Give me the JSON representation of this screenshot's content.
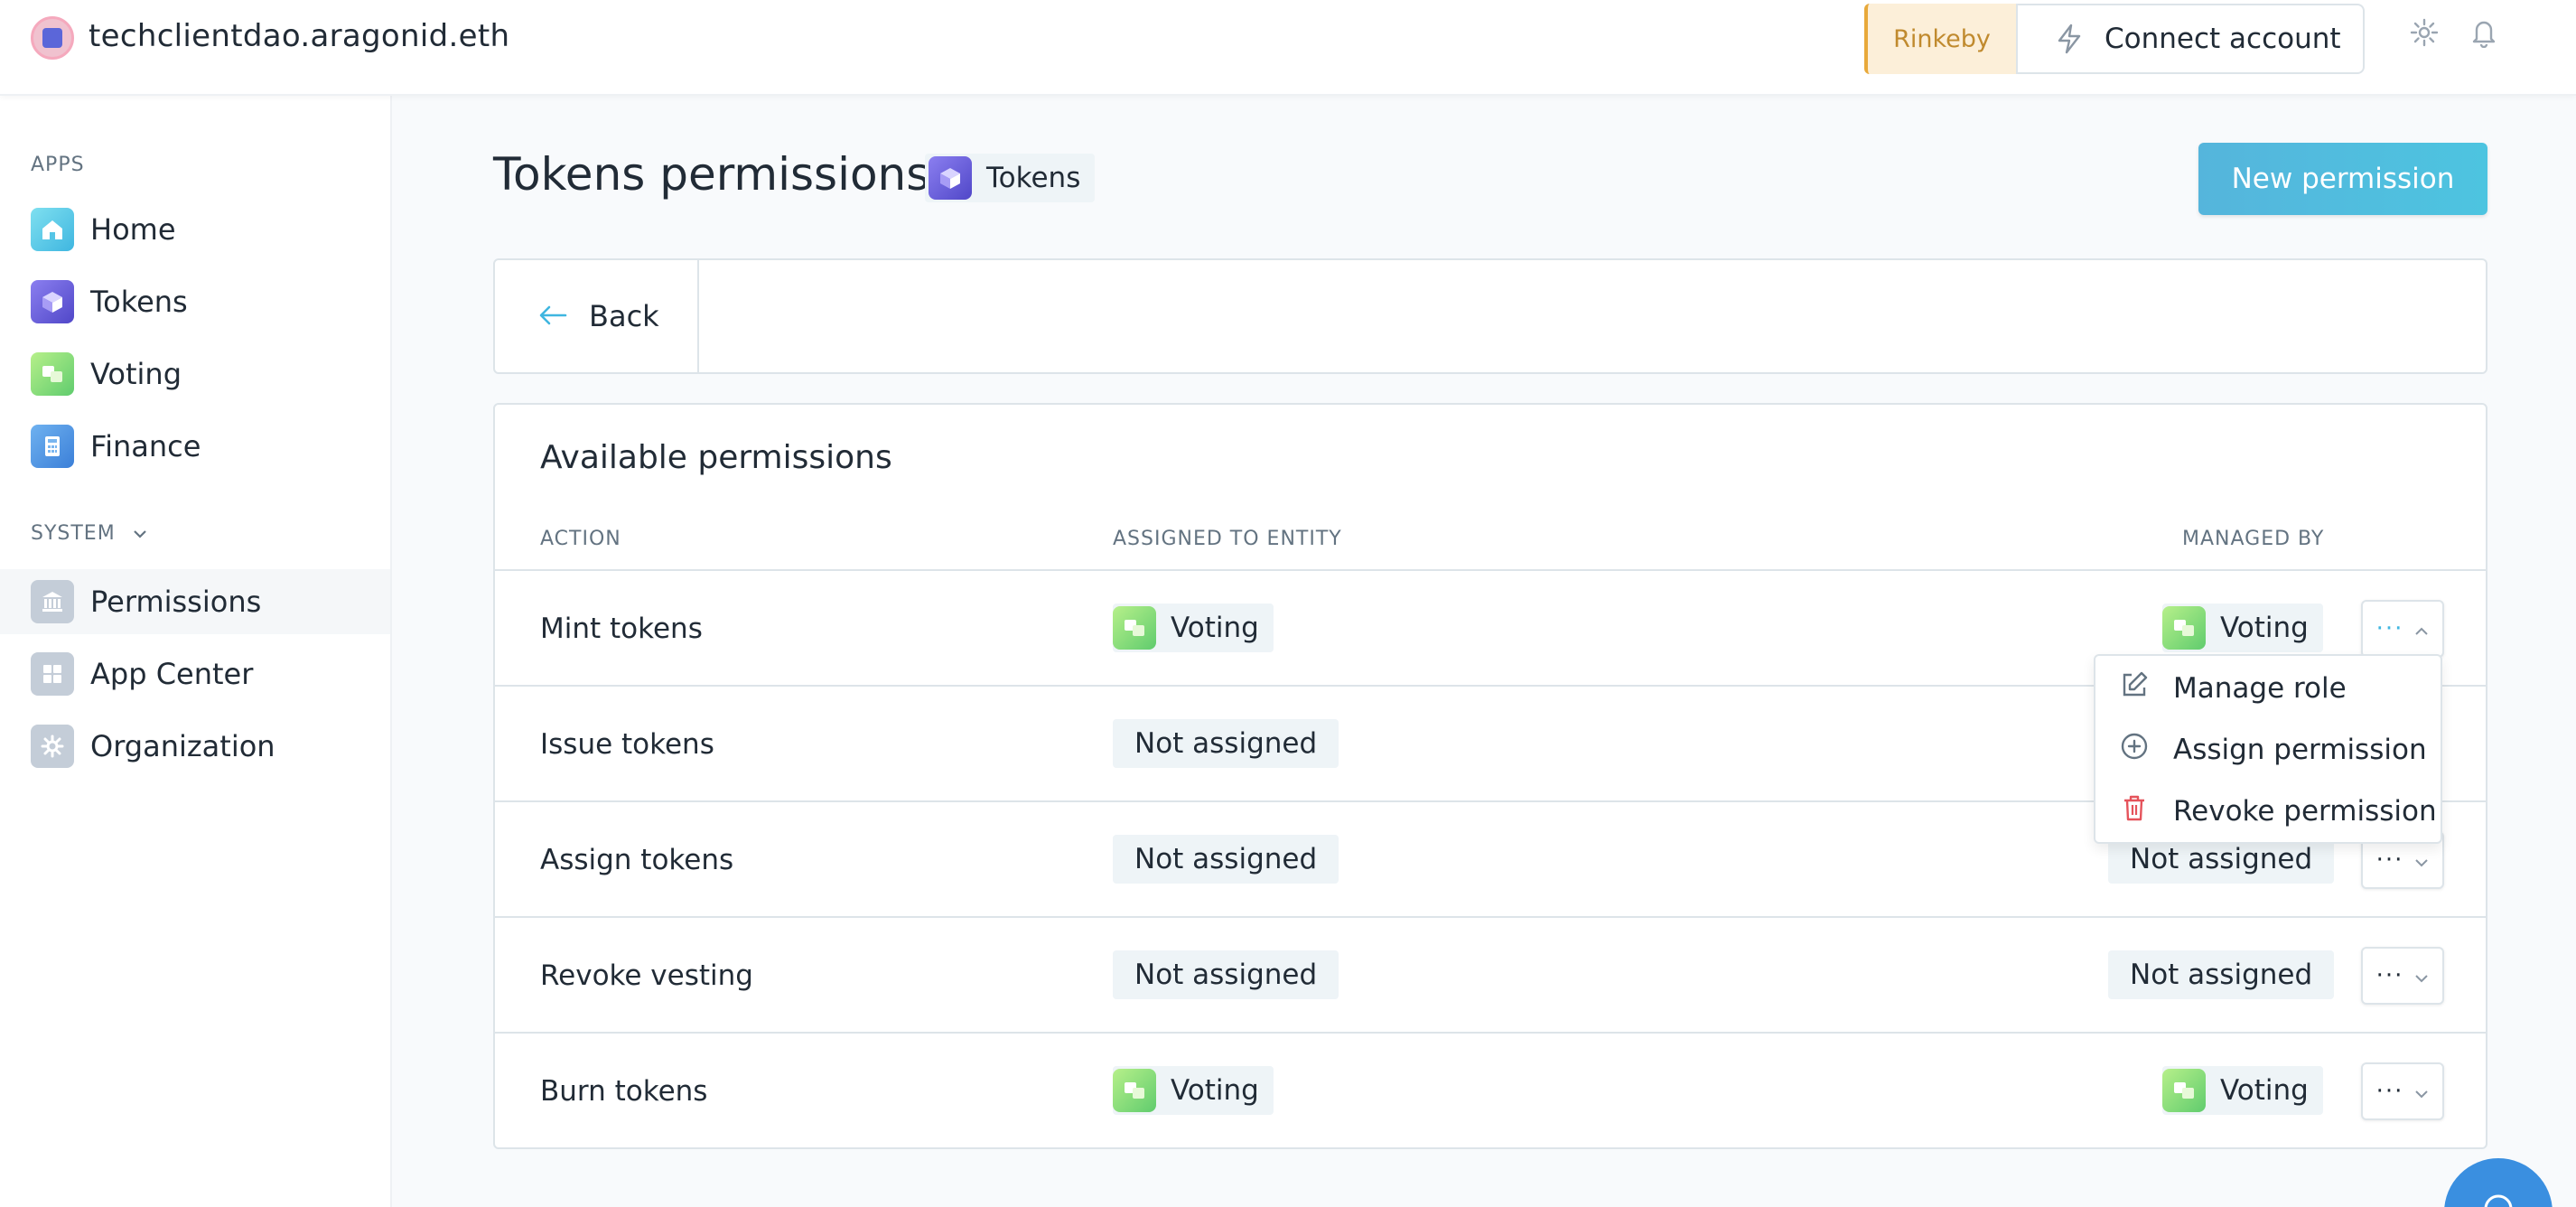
{
  "header": {
    "org_name": "techclientdao.aragonid.eth",
    "network": "Rinkeby",
    "connect_label": "Connect account",
    "icons": [
      "settings-icon",
      "notifications-icon"
    ]
  },
  "sidebar": {
    "apps_heading": "APPS",
    "apps": [
      {
        "label": "Home",
        "icon": "home-icon"
      },
      {
        "label": "Tokens",
        "icon": "tokens-icon"
      },
      {
        "label": "Voting",
        "icon": "voting-icon"
      },
      {
        "label": "Finance",
        "icon": "finance-icon"
      }
    ],
    "system_heading": "SYSTEM",
    "system": [
      {
        "label": "Permissions",
        "icon": "permissions-icon",
        "active": true
      },
      {
        "label": "App Center",
        "icon": "app-center-icon"
      },
      {
        "label": "Organization",
        "icon": "organization-icon"
      }
    ]
  },
  "main": {
    "title": "Tokens permissions",
    "app_tag": "Tokens",
    "new_permission_label": "New permission",
    "back_label": "Back",
    "box_title": "Available permissions",
    "columns": {
      "action": "ACTION",
      "assigned": "ASSIGNED TO ENTITY",
      "managed": "MANAGED BY"
    },
    "rows": [
      {
        "action": "Mint tokens",
        "assigned": "Voting",
        "managed": "Voting"
      },
      {
        "action": "Issue tokens",
        "assigned": "Not assigned",
        "managed": ""
      },
      {
        "action": "Assign tokens",
        "assigned": "Not assigned",
        "managed": "Not assigned"
      },
      {
        "action": "Revoke vesting",
        "assigned": "Not assigned",
        "managed": "Not assigned"
      },
      {
        "action": "Burn tokens",
        "assigned": "Voting",
        "managed": "Voting"
      }
    ],
    "more_label": "···",
    "menu": {
      "manage_role": "Manage role",
      "assign_permission": "Assign permission",
      "revoke_permission": "Revoke permission"
    }
  },
  "colors": {
    "accent": "#4dc4e0",
    "network_bg": "#fcefd9",
    "network_text": "#c08a2e",
    "danger": "#e5535b",
    "tag_bg": "#eef4f7"
  }
}
